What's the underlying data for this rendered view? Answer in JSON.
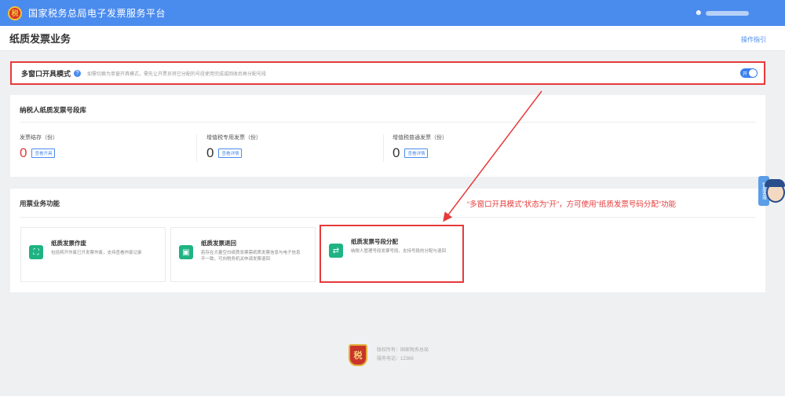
{
  "header": {
    "app_title": "国家税务总局电子发票服务平台",
    "logo_glyph": "税",
    "user_icon": "user-icon"
  },
  "page": {
    "title": "纸质发票业务",
    "guide_link": "操作指引"
  },
  "multi_window": {
    "label": "多窗口开具模式",
    "description": "如需切换为单窗开具模式，需先让开票员将已分配的号段使用完成或回收后再分配号段",
    "toggle_text": "开",
    "toggle_state": "on"
  },
  "stock": {
    "title": "纳税人纸质发票号段库",
    "items": [
      {
        "label": "发票结存（份）",
        "value": "0",
        "button": "查看开具"
      },
      {
        "label": "增值税专用发票（份）",
        "value": "0",
        "button": "查看详情"
      },
      {
        "label": "增值税普通发票（份）",
        "value": "0",
        "button": "查看详情"
      }
    ]
  },
  "functions": {
    "title": "用票业务功能",
    "annotation": "“多窗口开具模式”状态为“开”，方可使用“纸质发票号码分配”功能",
    "tiles": [
      {
        "icon": "⛶",
        "title": "纸质发票作废",
        "desc": "包括将开作废已开发票作废，支持查看作废记录"
      },
      {
        "icon": "▣",
        "title": "纸质发票退回",
        "desc": "若存在大量空白纸质发票需纸质发票信息与电子信息不一致，可向税务机关申请发票退回"
      },
      {
        "icon": "⇄",
        "title": "纸质发票号段分配",
        "desc": "纳税人管理号段发票号段，支持号段的分配与退回"
      }
    ]
  },
  "footer": {
    "logo_glyph": "税",
    "line1": "版权所有：国家税务总局",
    "line2": "服务电话：12366"
  },
  "assistant": {
    "label": "智能客服"
  },
  "colors": {
    "header_bg": "#4a8bee",
    "accent_red": "#e63a3a",
    "tile_icon": "#1fb383"
  }
}
